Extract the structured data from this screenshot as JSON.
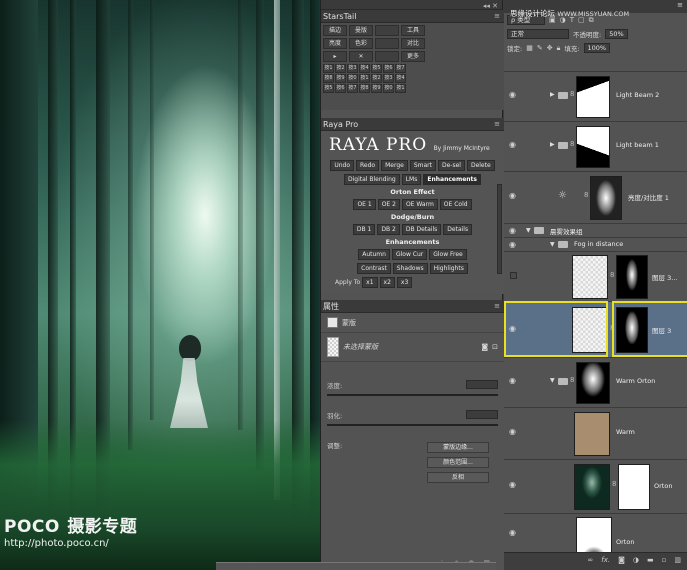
{
  "photo": {
    "watermark_logo": "POCO",
    "watermark_title": "摄影专题",
    "watermark_url": "http://photo.poco.cn/"
  },
  "site_watermark": {
    "name": "思缘设计论坛",
    "url": "WWW.MISSYUAN.COM"
  },
  "starstail": {
    "title": "StarsTail",
    "row1": [
      "描边",
      "曼版",
      "",
      "工具"
    ],
    "row2": [
      "亮度",
      "色彩",
      "",
      "对比"
    ],
    "row3": [
      "▸",
      "✕",
      "",
      "更多"
    ],
    "small_buttons": [
      "按1",
      "按2",
      "按3",
      "按4",
      "按5",
      "按6",
      "按7",
      "按8",
      "按9",
      "按0",
      "按1",
      "按2",
      "按3",
      "按4",
      "按5",
      "按6",
      "按7",
      "按8",
      "按9",
      "按0",
      "按1"
    ]
  },
  "raya": {
    "tab": "Raya Pro",
    "title": "RAYA PRO",
    "byline": "By Jimmy McIntyre",
    "row1": [
      "Undo",
      "Redo",
      "Merge",
      "Smart",
      "De-sel",
      "Delete"
    ],
    "row2": [
      "Digital Blending",
      "LMs",
      "Enhancements"
    ],
    "orton_label": "Orton Effect",
    "orton": [
      "OE 1",
      "OE 2",
      "OE Warm",
      "OE Cold"
    ],
    "dodge_label": "Dodge/Burn",
    "dodge": [
      "DB 1",
      "DB 2",
      "DB Details",
      "Details"
    ],
    "enh_label": "Enhancements",
    "enh1": [
      "Autumn",
      "Glow Cur",
      "Glow Free"
    ],
    "enh2": [
      "Contrast",
      "Shadows",
      "Highlights"
    ],
    "apply": "Apply To",
    "apply_btns": [
      "x1",
      "x2",
      "x3"
    ]
  },
  "properties": {
    "tab": "属性",
    "mask_label": "蒙版",
    "mask_name": "未选择蒙版",
    "density_label": "浓度:",
    "feather_label": "羽化:",
    "adjust_label": "调整:",
    "btn_edge": "蒙版边缘...",
    "btn_color": "颜色范围...",
    "btn_invert": "反相"
  },
  "layers": {
    "filter_kind": "ρ 类型",
    "blend_mode": "正常",
    "opacity_label": "不透明度:",
    "opacity_value": "50%",
    "lock_label": "锁定:",
    "fill_label": "填充:",
    "fill_value": "100%",
    "items": [
      {
        "name": "Light Beam 2"
      },
      {
        "name": "Light beam 1"
      },
      {
        "name": "亮度/对比度 1"
      },
      {
        "name": "晨雾效果组"
      },
      {
        "name": "Fog in distance"
      },
      {
        "name": "图层 3..."
      },
      {
        "name": "图层 3"
      },
      {
        "name": "Warm Orton"
      },
      {
        "name": "Warm"
      },
      {
        "name": "Orton"
      },
      {
        "name": "Orton"
      }
    ],
    "bottom_icons": [
      "link-icon",
      "fx-icon",
      "mask-icon",
      "adjust-icon",
      "folder-icon",
      "new-layer-icon",
      "trash-icon"
    ]
  }
}
